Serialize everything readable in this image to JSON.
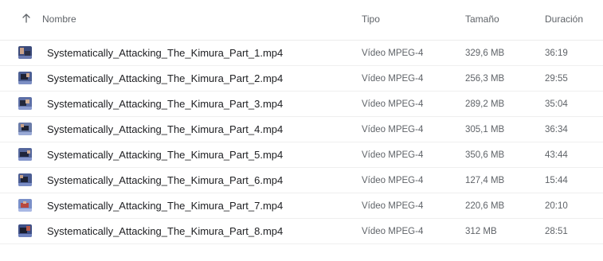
{
  "header": {
    "sort_icon": "arrow-up-icon",
    "name": "Nombre",
    "type": "Tipo",
    "size": "Tamaño",
    "duration": "Duración"
  },
  "files": [
    {
      "name": "Systematically_Attacking_The_Kimura_Part_1.mp4",
      "type": "Vídeo MPEG-4",
      "size": "329,6 MB",
      "duration": "36:19",
      "thumb_icon": "video-thumbnail-icon"
    },
    {
      "name": "Systematically_Attacking_The_Kimura_Part_2.mp4",
      "type": "Vídeo MPEG-4",
      "size": "256,3 MB",
      "duration": "29:55",
      "thumb_icon": "video-thumbnail-icon"
    },
    {
      "name": "Systematically_Attacking_The_Kimura_Part_3.mp4",
      "type": "Vídeo MPEG-4",
      "size": "289,2 MB",
      "duration": "35:04",
      "thumb_icon": "video-thumbnail-icon"
    },
    {
      "name": "Systematically_Attacking_The_Kimura_Part_4.mp4",
      "type": "Vídeo MPEG-4",
      "size": "305,1 MB",
      "duration": "36:34",
      "thumb_icon": "video-thumbnail-icon"
    },
    {
      "name": "Systematically_Attacking_The_Kimura_Part_5.mp4",
      "type": "Vídeo MPEG-4",
      "size": "350,6 MB",
      "duration": "43:44",
      "thumb_icon": "video-thumbnail-icon"
    },
    {
      "name": "Systematically_Attacking_The_Kimura_Part_6.mp4",
      "type": "Vídeo MPEG-4",
      "size": "127,4 MB",
      "duration": "15:44",
      "thumb_icon": "video-thumbnail-icon"
    },
    {
      "name": "Systematically_Attacking_The_Kimura_Part_7.mp4",
      "type": "Vídeo MPEG-4",
      "size": "220,6 MB",
      "duration": "20:10",
      "thumb_icon": "video-thumbnail-icon"
    },
    {
      "name": "Systematically_Attacking_The_Kimura_Part_8.mp4",
      "type": "Vídeo MPEG-4",
      "size": "312 MB",
      "duration": "28:51",
      "thumb_icon": "video-thumbnail-icon"
    }
  ],
  "colors": {
    "header_text": "#5f6368",
    "row_text": "#202124",
    "divider": "#efefef"
  }
}
